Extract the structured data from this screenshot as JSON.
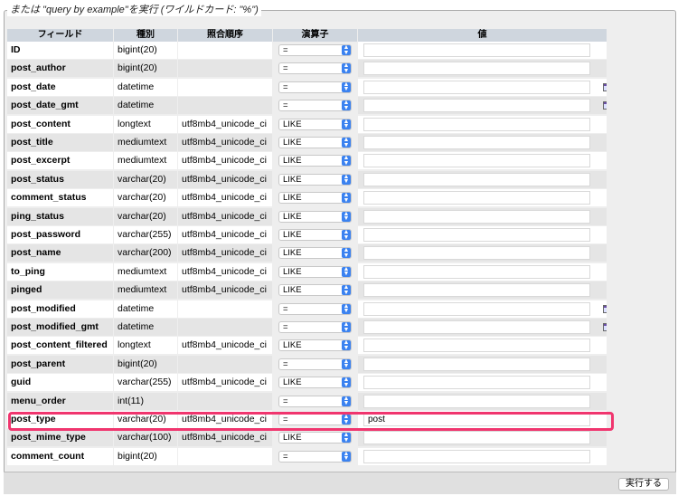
{
  "legend": "または \"query by example\"を実行 (ワイルドカード: \"%\")",
  "columns": {
    "field": "フィールド",
    "type": "種別",
    "collation": "照合順序",
    "operator": "演算子",
    "value": "値"
  },
  "rows": [
    {
      "field": "ID",
      "type": "bigint(20)",
      "collation": "",
      "operator": "=",
      "value": "",
      "calendar": false
    },
    {
      "field": "post_author",
      "type": "bigint(20)",
      "collation": "",
      "operator": "=",
      "value": "",
      "calendar": false
    },
    {
      "field": "post_date",
      "type": "datetime",
      "collation": "",
      "operator": "=",
      "value": "",
      "calendar": true
    },
    {
      "field": "post_date_gmt",
      "type": "datetime",
      "collation": "",
      "operator": "=",
      "value": "",
      "calendar": true
    },
    {
      "field": "post_content",
      "type": "longtext",
      "collation": "utf8mb4_unicode_ci",
      "operator": "LIKE",
      "value": "",
      "calendar": false
    },
    {
      "field": "post_title",
      "type": "mediumtext",
      "collation": "utf8mb4_unicode_ci",
      "operator": "LIKE",
      "value": "",
      "calendar": false
    },
    {
      "field": "post_excerpt",
      "type": "mediumtext",
      "collation": "utf8mb4_unicode_ci",
      "operator": "LIKE",
      "value": "",
      "calendar": false
    },
    {
      "field": "post_status",
      "type": "varchar(20)",
      "collation": "utf8mb4_unicode_ci",
      "operator": "LIKE",
      "value": "",
      "calendar": false
    },
    {
      "field": "comment_status",
      "type": "varchar(20)",
      "collation": "utf8mb4_unicode_ci",
      "operator": "LIKE",
      "value": "",
      "calendar": false
    },
    {
      "field": "ping_status",
      "type": "varchar(20)",
      "collation": "utf8mb4_unicode_ci",
      "operator": "LIKE",
      "value": "",
      "calendar": false
    },
    {
      "field": "post_password",
      "type": "varchar(255)",
      "collation": "utf8mb4_unicode_ci",
      "operator": "LIKE",
      "value": "",
      "calendar": false
    },
    {
      "field": "post_name",
      "type": "varchar(200)",
      "collation": "utf8mb4_unicode_ci",
      "operator": "LIKE",
      "value": "",
      "calendar": false
    },
    {
      "field": "to_ping",
      "type": "mediumtext",
      "collation": "utf8mb4_unicode_ci",
      "operator": "LIKE",
      "value": "",
      "calendar": false
    },
    {
      "field": "pinged",
      "type": "mediumtext",
      "collation": "utf8mb4_unicode_ci",
      "operator": "LIKE",
      "value": "",
      "calendar": false
    },
    {
      "field": "post_modified",
      "type": "datetime",
      "collation": "",
      "operator": "=",
      "value": "",
      "calendar": true
    },
    {
      "field": "post_modified_gmt",
      "type": "datetime",
      "collation": "",
      "operator": "=",
      "value": "",
      "calendar": true
    },
    {
      "field": "post_content_filtered",
      "type": "longtext",
      "collation": "utf8mb4_unicode_ci",
      "operator": "LIKE",
      "value": "",
      "calendar": false
    },
    {
      "field": "post_parent",
      "type": "bigint(20)",
      "collation": "",
      "operator": "=",
      "value": "",
      "calendar": false
    },
    {
      "field": "guid",
      "type": "varchar(255)",
      "collation": "utf8mb4_unicode_ci",
      "operator": "LIKE",
      "value": "",
      "calendar": false
    },
    {
      "field": "menu_order",
      "type": "int(11)",
      "collation": "",
      "operator": "=",
      "value": "",
      "calendar": false
    },
    {
      "field": "post_type",
      "type": "varchar(20)",
      "collation": "utf8mb4_unicode_ci",
      "operator": "=",
      "value": "post",
      "calendar": false,
      "highlighted": true
    },
    {
      "field": "post_mime_type",
      "type": "varchar(100)",
      "collation": "utf8mb4_unicode_ci",
      "operator": "LIKE",
      "value": "",
      "calendar": false
    },
    {
      "field": "comment_count",
      "type": "bigint(20)",
      "collation": "",
      "operator": "=",
      "value": "",
      "calendar": false
    }
  ],
  "execute_label": "実行する",
  "colors": {
    "highlight": "#f0356e",
    "header": "#cfd6de",
    "select_arrow": "#3b82f0"
  }
}
